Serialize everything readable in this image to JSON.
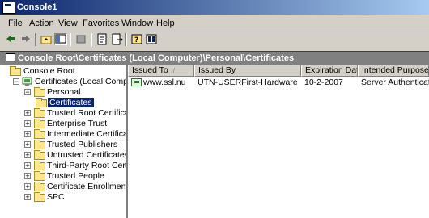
{
  "window": {
    "title": "Console1"
  },
  "menu": [
    "File",
    "Action",
    "View",
    "Favorites",
    "Window",
    "Help"
  ],
  "toolbar": {
    "buttons": [
      "back-arrow-icon",
      "forward-arrow-icon",
      "up-folder-icon",
      "show-hide-tree-icon",
      "delete-icon",
      "properties-icon",
      "export-list-icon",
      "help-icon",
      "snapin-help-icon"
    ]
  },
  "pathbar": {
    "path": "Console Root\\Certificates (Local Computer)\\Personal\\Certificates"
  },
  "tree": {
    "root": "Console Root",
    "certificates_local": "Certificates (Local Computer)",
    "personal": "Personal",
    "personal_certificates": "Certificates",
    "stores": [
      "Trusted Root Certification",
      "Enterprise Trust",
      "Intermediate Certification",
      "Trusted Publishers",
      "Untrusted Certificates",
      "Third-Party Root Certificat",
      "Trusted People",
      "Certificate Enrollment Re",
      "SPC"
    ]
  },
  "list": {
    "columns": [
      "Issued To",
      "Issued By",
      "Expiration Date",
      "Intended Purposes"
    ],
    "sort_indicator": "/",
    "rows": [
      {
        "issued_to": "www.ssl.nu",
        "issued_by": "UTN-USERFirst-Hardware",
        "expiration": "10-2-2007",
        "purposes": "Server Authenticatio..."
      }
    ]
  }
}
